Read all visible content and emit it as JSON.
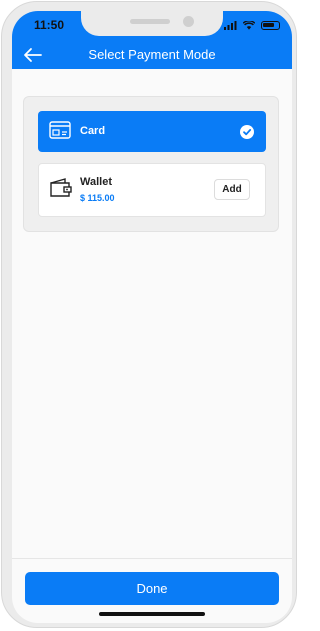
{
  "status": {
    "time": "11:50"
  },
  "header": {
    "title": "Select Payment Mode"
  },
  "options": [
    {
      "label": "Card",
      "selected": true,
      "icon": "credit-card-icon"
    },
    {
      "label": "Wallet",
      "amount": "$ 115.00",
      "action": "Add",
      "icon": "wallet-icon"
    }
  ],
  "footer": {
    "done_label": "Done"
  },
  "colors": {
    "accent": "#0a7cf6",
    "background": "#fafafa",
    "panel": "#efefef"
  }
}
